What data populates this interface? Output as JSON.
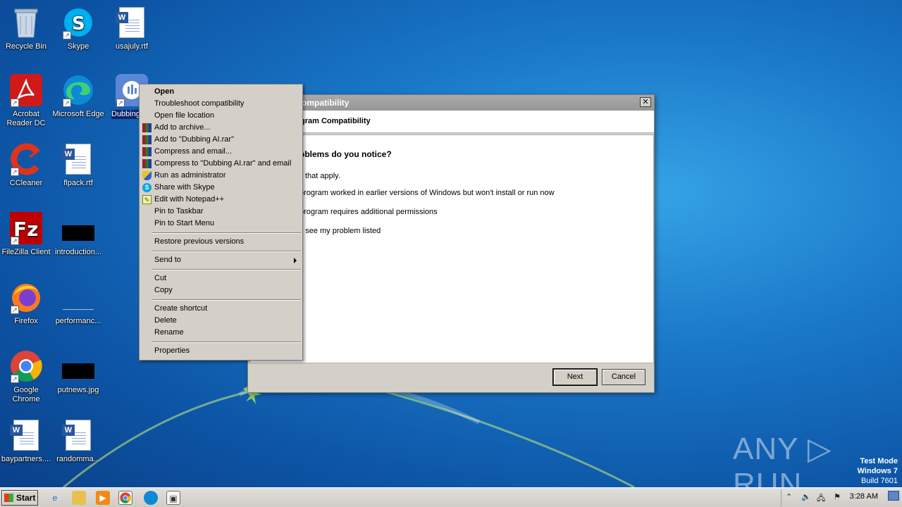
{
  "desktop": {
    "icons": [
      {
        "label": "Recycle Bin",
        "icon": "recycle-bin-icon"
      },
      {
        "label": "Skype",
        "icon": "skype-icon"
      },
      {
        "label": "usajuly.rtf",
        "icon": "word-doc-icon"
      },
      {
        "label": "Acrobat Reader DC",
        "icon": "acrobat-icon"
      },
      {
        "label": "Microsoft Edge",
        "icon": "edge-icon"
      },
      {
        "label": "Dubbing",
        "icon": "dubbing-ai-icon"
      },
      {
        "label": "CCleaner",
        "icon": "ccleaner-icon"
      },
      {
        "label": "flpack.rtf",
        "icon": "word-doc-icon"
      },
      {
        "label": "FileZilla Client",
        "icon": "filezilla-icon"
      },
      {
        "label": "introduction...",
        "icon": "black-image-icon"
      },
      {
        "label": "Firefox",
        "icon": "firefox-icon"
      },
      {
        "label": "performanc...",
        "icon": "image-file-icon"
      },
      {
        "label": "Google Chrome",
        "icon": "chrome-icon"
      },
      {
        "label": "putnews.jpg",
        "icon": "black-image-icon"
      },
      {
        "label": "baypartners....",
        "icon": "word-doc-icon"
      },
      {
        "label": "randomma...",
        "icon": "word-doc-icon"
      }
    ]
  },
  "dialog": {
    "title": "ompatibility",
    "header": "gram Compatibility",
    "question": "oblems do you notice?",
    "hint": "ll that apply.",
    "options": [
      "program worked in earlier versions of Windows but won't install or run now",
      "program requires additional permissions",
      "'t see my problem listed"
    ],
    "next_label": "Next",
    "cancel_label": "Cancel",
    "close_glyph": "✕"
  },
  "context_menu": {
    "items": [
      {
        "label": "Open",
        "icon": ""
      },
      {
        "label": "Troubleshoot compatibility",
        "icon": ""
      },
      {
        "label": "Open file location",
        "icon": ""
      },
      {
        "label": "Add to archive...",
        "icon": "winrar-icon"
      },
      {
        "label": "Add to \"Dubbing AI.rar\"",
        "icon": "winrar-icon"
      },
      {
        "label": "Compress and email...",
        "icon": "winrar-icon"
      },
      {
        "label": "Compress to \"Dubbing AI.rar\" and email",
        "icon": "winrar-icon"
      },
      {
        "label": "Run as administrator",
        "icon": "uac-shield-icon"
      },
      {
        "label": "Share with Skype",
        "icon": "skype-icon"
      },
      {
        "label": "Edit with Notepad++",
        "icon": "notepadpp-icon"
      },
      {
        "label": "Pin to Taskbar",
        "icon": ""
      },
      {
        "label": "Pin to Start Menu",
        "icon": ""
      },
      {
        "label": "Restore previous versions",
        "icon": ""
      },
      {
        "label": "Send to",
        "icon": ""
      },
      {
        "label": "Cut",
        "icon": ""
      },
      {
        "label": "Copy",
        "icon": ""
      },
      {
        "label": "Create shortcut",
        "icon": ""
      },
      {
        "label": "Delete",
        "icon": ""
      },
      {
        "label": "Rename",
        "icon": ""
      },
      {
        "label": "Properties",
        "icon": ""
      }
    ]
  },
  "watermark": {
    "text": "ANY ▷ RUN",
    "test_mode": "Test Mode",
    "os": "Windows 7",
    "build": "Build 7601"
  },
  "taskbar": {
    "start_label": "Start",
    "clock": "3:28 AM",
    "tray_icons": [
      "show-hidden-icons-icon",
      "volume-icon",
      "network-icon",
      "action-center-flag-icon"
    ],
    "pinned": [
      "internet-explorer-icon",
      "explorer-folder-icon",
      "media-player-icon",
      "chrome-icon",
      "edge-icon",
      "program-compatibility-icon"
    ]
  }
}
